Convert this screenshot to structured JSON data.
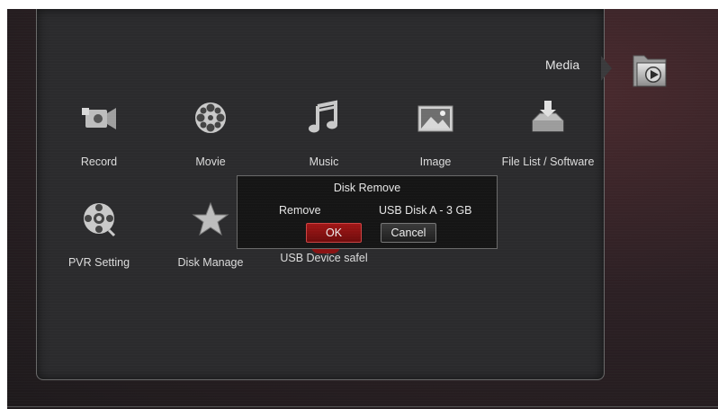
{
  "section": {
    "title": "Media",
    "tab_icon": "media-folder-icon"
  },
  "menu": {
    "items": [
      {
        "label": "Record",
        "icon": "record-camera-icon"
      },
      {
        "label": "Movie",
        "icon": "film-reel-icon"
      },
      {
        "label": "Music",
        "icon": "music-note-icon"
      },
      {
        "label": "Image",
        "icon": "image-icon"
      },
      {
        "label": "File List / Software",
        "icon": "file-list-icon"
      },
      {
        "label": "PVR Setting",
        "icon": "pvr-reel-icon"
      },
      {
        "label": "Disk Manage",
        "icon": "star-icon"
      },
      {
        "label": "USB Device safel",
        "icon": "usb-device-icon"
      }
    ]
  },
  "dialog": {
    "title": "Disk Remove",
    "remove_label": "Remove",
    "device": "USB Disk A - 3 GB",
    "ok_label": "OK",
    "cancel_label": "Cancel"
  },
  "colors": {
    "ok_button": "#a11616",
    "panel": "#2b2b2d",
    "dialog": "#151515"
  }
}
